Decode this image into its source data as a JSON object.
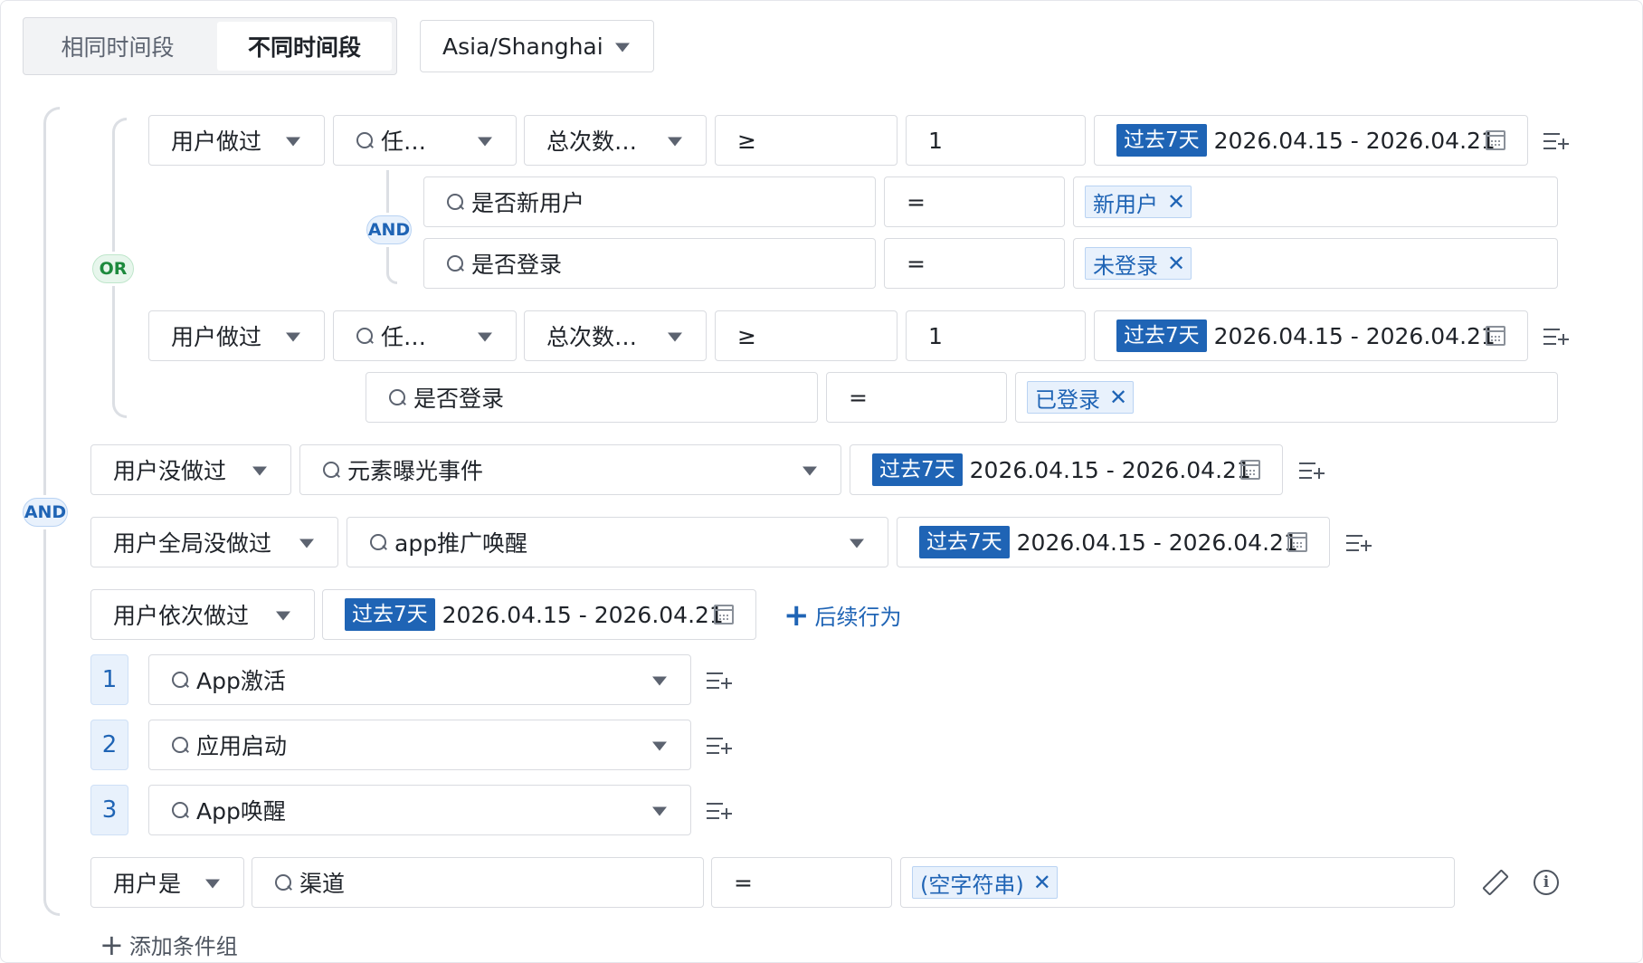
{
  "time_mode": {
    "same": "相同时间段",
    "different": "不同时间段"
  },
  "timezone": "Asia/Shanghai",
  "logic": {
    "and": "AND",
    "or": "OR"
  },
  "date_range": {
    "preset": "过去7天",
    "range": "2026.04.15 - 2026.04.21"
  },
  "event_group_1": {
    "action": "用户做过",
    "event": "任…",
    "metric": "总次数…",
    "operator": "≥",
    "value": "1",
    "filters": [
      {
        "property": "是否新用户",
        "operator": "=",
        "value": "新用户"
      },
      {
        "property": "是否登录",
        "operator": "=",
        "value": "未登录"
      }
    ]
  },
  "event_group_2": {
    "action": "用户做过",
    "event": "任…",
    "metric": "总次数…",
    "operator": "≥",
    "value": "1",
    "filters": [
      {
        "property": "是否登录",
        "operator": "=",
        "value": "已登录"
      }
    ]
  },
  "not_done": {
    "action": "用户没做过",
    "event": "元素曝光事件"
  },
  "global_not_done": {
    "action": "用户全局没做过",
    "event": "app推广唤醒"
  },
  "sequence": {
    "action": "用户依次做过",
    "add_label": "后续行为",
    "steps": [
      {
        "num": "1",
        "event": "App激活"
      },
      {
        "num": "2",
        "event": "应用启动"
      },
      {
        "num": "3",
        "event": "App唤醒"
      }
    ]
  },
  "user_attr": {
    "action": "用户是",
    "property": "渠道",
    "operator": "=",
    "value": "(空字符串)"
  },
  "add_group_label": "添加条件组",
  "icons": {
    "edit": "pencil-icon",
    "info": "info-icon",
    "add_row": "add-filter-icon",
    "calendar": "calendar-icon",
    "search": "search-icon",
    "close": "close-icon"
  },
  "colors": {
    "primary": "#1f64b5",
    "or_green": "#1d8a3d",
    "border": "#d9dbe0"
  }
}
